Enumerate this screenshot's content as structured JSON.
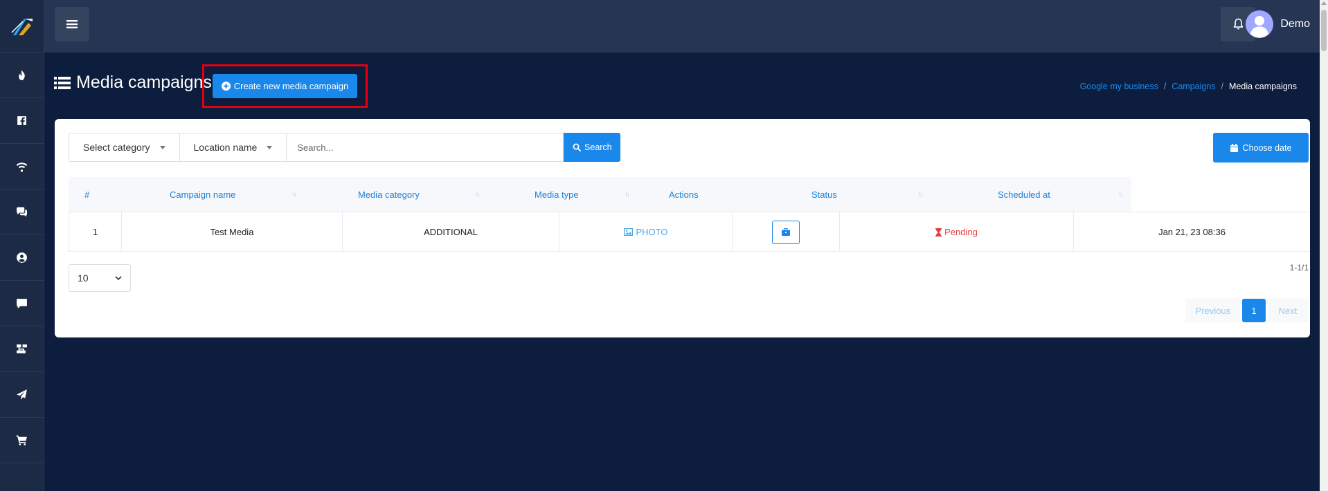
{
  "topbar": {
    "user_name": "Demo"
  },
  "sidebar": {
    "items": [
      {
        "icon": "fire-icon"
      },
      {
        "icon": "facebook-icon"
      },
      {
        "icon": "wifi-icon"
      },
      {
        "icon": "comments-icon"
      },
      {
        "icon": "user-circle-icon"
      },
      {
        "icon": "comment-icon"
      },
      {
        "icon": "sitemap-icon"
      },
      {
        "icon": "paper-plane-icon"
      },
      {
        "icon": "cart-icon"
      }
    ]
  },
  "page": {
    "title": "Media campaigns",
    "create_button": "Create new media campaign",
    "breadcrumb": [
      "Google my business",
      "Campaigns",
      "Media campaigns"
    ]
  },
  "filters": {
    "category": "Select category",
    "location": "Location name",
    "search_placeholder": "Search...",
    "search_button": "Search",
    "date_button": "Choose date"
  },
  "table": {
    "headers": [
      "#",
      "Campaign name",
      "Media category",
      "Media type",
      "Actions",
      "Status",
      "Scheduled at"
    ],
    "rows": [
      {
        "index": "1",
        "campaign_name": "Test Media",
        "media_category": "ADDITIONAL",
        "media_type": "PHOTO",
        "status": "Pending",
        "scheduled_at": "Jan 21, 23 08:36"
      }
    ]
  },
  "pagination": {
    "page_size": "10",
    "range": "1-1/1",
    "previous": "Previous",
    "current": "1",
    "next": "Next"
  },
  "colors": {
    "background": "#0d1d3d",
    "accent": "#1a87ea",
    "highlight": "#e4000f",
    "pending": "#e43d3d"
  }
}
